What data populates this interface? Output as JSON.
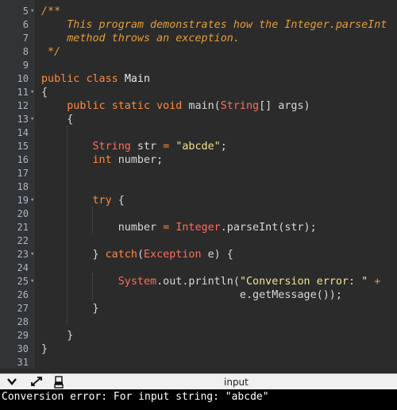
{
  "editor": {
    "lines": [
      {
        "n": "5",
        "fold": "▾",
        "segs": [
          [
            "cm",
            "/**"
          ]
        ]
      },
      {
        "n": "6",
        "fold": "",
        "segs": [
          [
            "cm",
            "    This program demonstrates how the Integer.parseInt"
          ]
        ]
      },
      {
        "n": "7",
        "fold": "",
        "segs": [
          [
            "cm",
            "    method throws an exception."
          ]
        ]
      },
      {
        "n": "8",
        "fold": "",
        "segs": [
          [
            "cm",
            " */"
          ]
        ]
      },
      {
        "n": "9",
        "fold": "",
        "segs": []
      },
      {
        "n": "10",
        "fold": "",
        "segs": [
          [
            "kw",
            "public"
          ],
          [
            "txt",
            " "
          ],
          [
            "kw",
            "class"
          ],
          [
            "txt",
            " "
          ],
          [
            "id",
            "Main"
          ]
        ]
      },
      {
        "n": "11",
        "fold": "▾",
        "segs": [
          [
            "txt",
            "{"
          ]
        ]
      },
      {
        "n": "12",
        "fold": "",
        "segs": [
          [
            "txt",
            "    "
          ],
          [
            "kw",
            "public"
          ],
          [
            "txt",
            " "
          ],
          [
            "kw",
            "static"
          ],
          [
            "txt",
            " "
          ],
          [
            "kw",
            "void"
          ],
          [
            "txt",
            " main("
          ],
          [
            "ty",
            "String"
          ],
          [
            "txt",
            "[] args)"
          ]
        ]
      },
      {
        "n": "13",
        "fold": "▾",
        "segs": [
          [
            "txt",
            "    {"
          ]
        ]
      },
      {
        "n": "14",
        "fold": "",
        "segs": []
      },
      {
        "n": "15",
        "fold": "",
        "segs": [
          [
            "txt",
            "        "
          ],
          [
            "ty",
            "String"
          ],
          [
            "txt",
            " str "
          ],
          [
            "kw",
            "="
          ],
          [
            "txt",
            " "
          ],
          [
            "str",
            "\"abcde\""
          ],
          [
            "txt",
            ";"
          ]
        ]
      },
      {
        "n": "16",
        "fold": "",
        "segs": [
          [
            "txt",
            "        "
          ],
          [
            "kw",
            "int"
          ],
          [
            "txt",
            " number;"
          ]
        ]
      },
      {
        "n": "17",
        "fold": "",
        "segs": []
      },
      {
        "n": "18",
        "fold": "",
        "segs": []
      },
      {
        "n": "19",
        "fold": "▾",
        "segs": [
          [
            "txt",
            "        "
          ],
          [
            "kw",
            "try"
          ],
          [
            "txt",
            " {"
          ]
        ]
      },
      {
        "n": "20",
        "fold": "",
        "segs": []
      },
      {
        "n": "21",
        "fold": "",
        "segs": [
          [
            "txt",
            "            number "
          ],
          [
            "kw",
            "="
          ],
          [
            "txt",
            " "
          ],
          [
            "ty",
            "Integer"
          ],
          [
            "txt",
            ".parseInt(str);"
          ]
        ]
      },
      {
        "n": "22",
        "fold": "",
        "segs": []
      },
      {
        "n": "23",
        "fold": "▾",
        "segs": [
          [
            "txt",
            "        } "
          ],
          [
            "kw",
            "catch"
          ],
          [
            "txt",
            "("
          ],
          [
            "ty",
            "Exception"
          ],
          [
            "txt",
            " e) {"
          ]
        ]
      },
      {
        "n": "24",
        "fold": "",
        "segs": []
      },
      {
        "n": "25",
        "fold": "▾",
        "segs": [
          [
            "txt",
            "            "
          ],
          [
            "ty",
            "System"
          ],
          [
            "txt",
            ".out.println("
          ],
          [
            "str",
            "\"Conversion error: \""
          ],
          [
            "txt",
            " "
          ],
          [
            "kw",
            "+"
          ]
        ]
      },
      {
        "n": "26",
        "fold": "",
        "segs": [
          [
            "txt",
            "                               e.getMessage());"
          ]
        ]
      },
      {
        "n": "27",
        "fold": "",
        "segs": [
          [
            "txt",
            "        }"
          ]
        ]
      },
      {
        "n": "28",
        "fold": "",
        "segs": []
      },
      {
        "n": "29",
        "fold": "",
        "segs": [
          [
            "txt",
            "    }"
          ]
        ]
      },
      {
        "n": "30",
        "fold": "",
        "segs": [
          [
            "txt",
            "}"
          ]
        ]
      },
      {
        "n": "31",
        "fold": "",
        "segs": []
      }
    ]
  },
  "statusbar": {
    "icons": [
      "chevron-down-icon",
      "expand-icon",
      "clear-console-icon"
    ],
    "input_label": "input"
  },
  "console": {
    "output": "Conversion error: For input string: \"abcde\""
  }
}
